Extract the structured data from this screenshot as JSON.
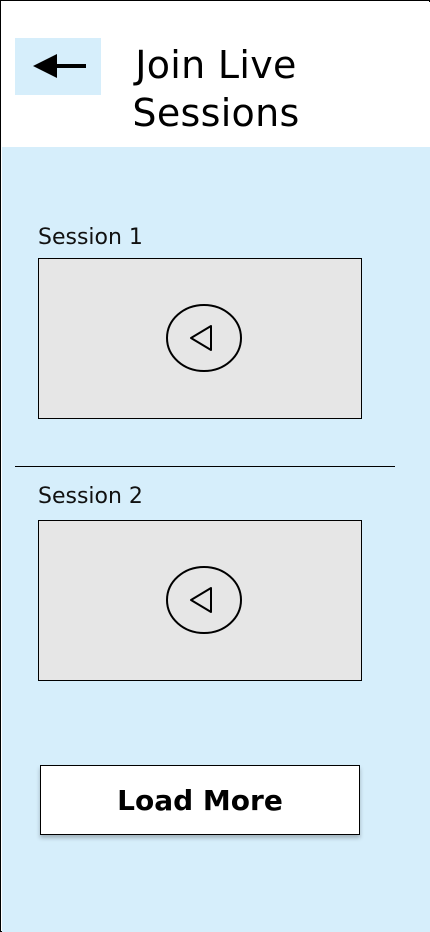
{
  "header": {
    "back_icon": "arrow-left-icon",
    "title_line1": "Join Live",
    "title_line2": "Sessions"
  },
  "sessions": [
    {
      "label": "Session 1",
      "play_icon": "play-icon"
    },
    {
      "label": "Session 2",
      "play_icon": "play-icon"
    }
  ],
  "load_more_label": "Load More",
  "colors": {
    "content_background": "#d6eefb",
    "back_button_background": "#d6eefb",
    "video_placeholder": "#e6e6e6",
    "header_background": "#ffffff"
  }
}
